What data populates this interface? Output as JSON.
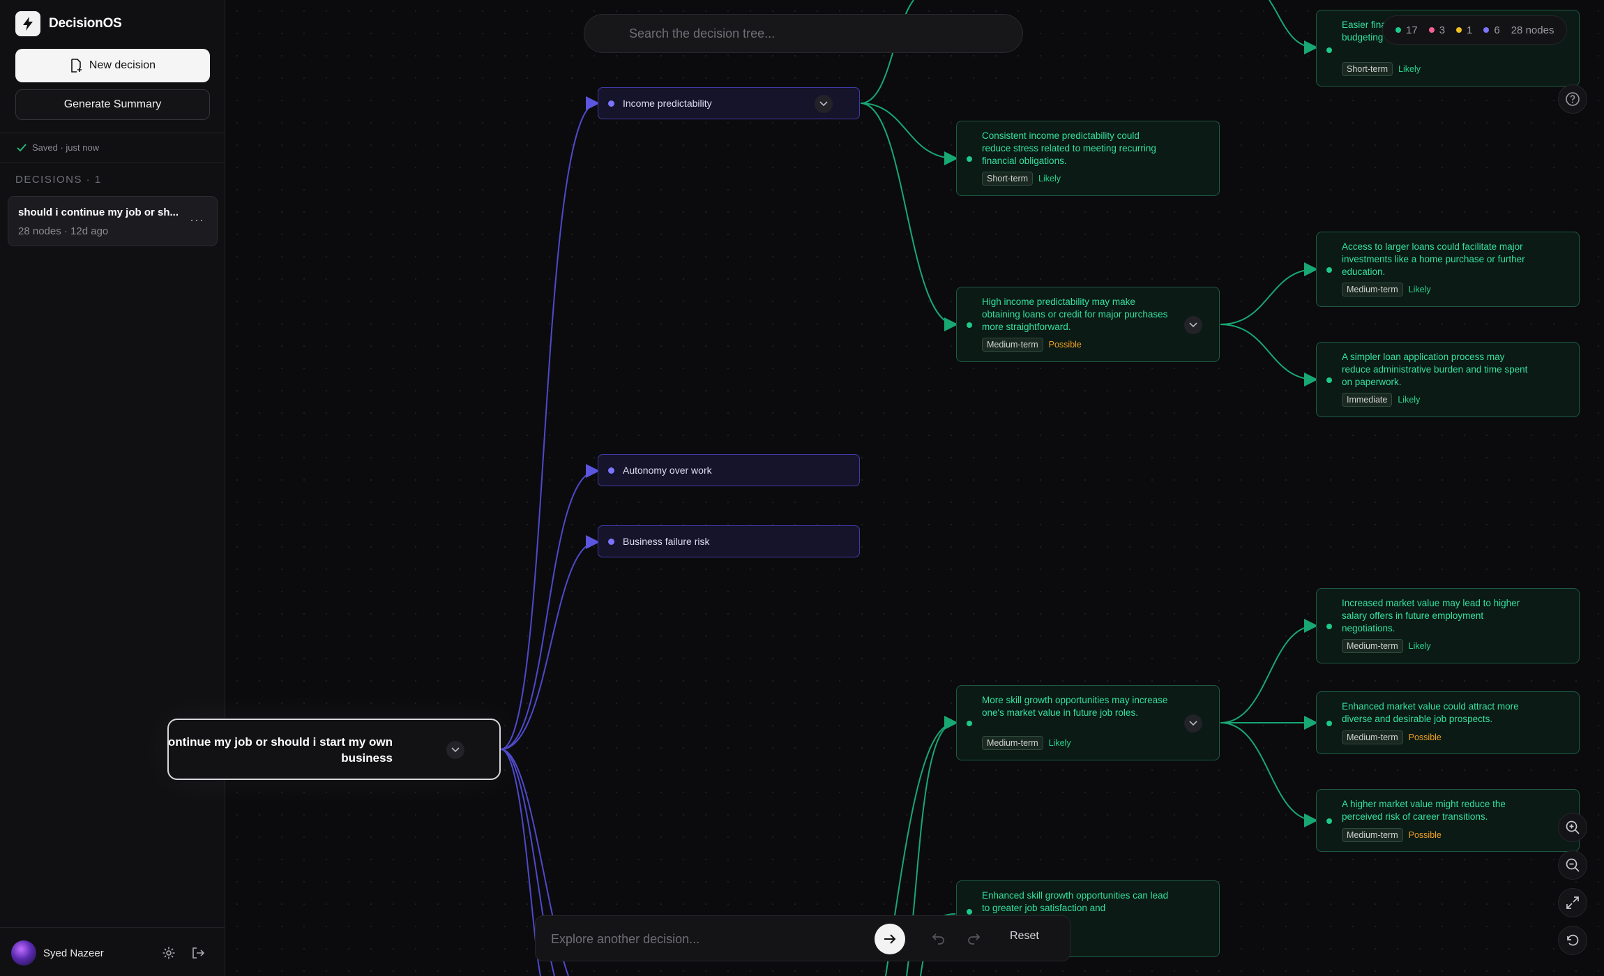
{
  "app": {
    "name": "DecisionOS"
  },
  "sidebar": {
    "new_decision_label": "New decision",
    "generate_summary_label": "Generate Summary",
    "saved_status": "Saved · just now",
    "decisions_header": "DECISIONS · 1",
    "decisions": [
      {
        "title": "should i continue my job or sh...",
        "meta": "28 nodes · 12d ago"
      }
    ],
    "user_name": "Syed Nazeer"
  },
  "search": {
    "placeholder": "Search the decision tree..."
  },
  "stats": {
    "green": "17",
    "pink": "3",
    "yellow": "1",
    "purple": "6",
    "total": "28 nodes"
  },
  "colors": {
    "green": "#1fc98a",
    "pink": "#f06292",
    "yellow": "#f0c020",
    "purple": "#7b74ff",
    "edge_purple": "#5b55e0",
    "edge_green": "#18a874"
  },
  "tree": {
    "root": {
      "label": "should i continue my job or should i start my own business"
    },
    "factors": [
      {
        "label": "Income predictability"
      },
      {
        "label": "Autonomy over work"
      },
      {
        "label": "Business failure risk"
      }
    ],
    "consequences": [
      {
        "text": "Easier financial planning and more accurate budgeting of spending capacity.",
        "term": "Short-term",
        "likelihood": "Likely"
      },
      {
        "text": "Consistent income predictability could reduce stress related to meeting recurring financial obligations.",
        "term": "Short-term",
        "likelihood": "Likely"
      },
      {
        "text": "High income predictability may make obtaining loans or credit for major purchases more straightforward.",
        "term": "Medium-term",
        "likelihood": "Possible"
      },
      {
        "text": "Access to larger loans could facilitate major investments like a home purchase or further education.",
        "term": "Medium-term",
        "likelihood": "Likely"
      },
      {
        "text": "A simpler loan application process may reduce administrative burden and time spent on paperwork.",
        "term": "Immediate",
        "likelihood": "Likely"
      },
      {
        "text": "Increased market value may lead to higher salary offers in future employment negotiations.",
        "term": "Medium-term",
        "likelihood": "Likely"
      },
      {
        "text": "More skill growth opportunities may increase one's market value in future job roles.",
        "term": "Medium-term",
        "likelihood": "Likely"
      },
      {
        "text": "Enhanced market value could attract more diverse and desirable job prospects.",
        "term": "Medium-term",
        "likelihood": "Possible"
      },
      {
        "text": "A higher market value might reduce the perceived risk of career transitions.",
        "term": "Medium-term",
        "likelihood": "Possible"
      },
      {
        "text": "Enhanced skill growth opportunities can lead to greater job satisfaction and",
        "term": "",
        "likelihood": ""
      }
    ]
  },
  "bottom": {
    "placeholder": "Explore another decision...",
    "reset_label": "Reset"
  }
}
